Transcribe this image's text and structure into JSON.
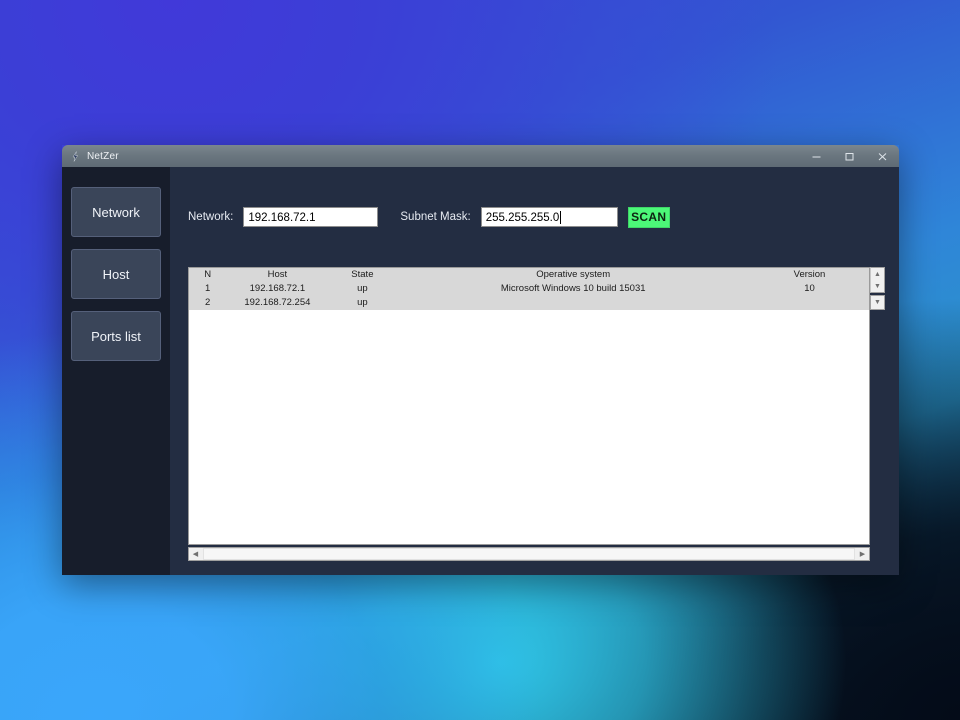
{
  "window": {
    "title": "NetZer",
    "icon": "app-lightning-icon",
    "controls": {
      "minimize": "–",
      "maximize": "☐",
      "close": "✕"
    }
  },
  "sidebar": {
    "items": [
      {
        "label": "Network"
      },
      {
        "label": "Host"
      },
      {
        "label": "Ports list"
      }
    ]
  },
  "form": {
    "network_label": "Network:",
    "network_value": "192.168.72.1",
    "network_placeholder": "",
    "subnet_label": "Subnet Mask:",
    "subnet_value": "255.255.255.0",
    "subnet_placeholder": "",
    "scan_label": "SCAN"
  },
  "results_table": {
    "columns": [
      "N",
      "Host",
      "State",
      "Operative system",
      "Version"
    ],
    "rows": [
      {
        "n": "1",
        "host": "192.168.72.1",
        "state": "up",
        "os": "Microsoft Windows 10 build 15031",
        "version": "10"
      },
      {
        "n": "2",
        "host": "192.168.72.254",
        "state": "up",
        "os": "",
        "version": ""
      }
    ]
  },
  "scrollbars": {
    "up_arrow": "▲",
    "down_arrow": "▼",
    "left_arrow": "◀",
    "right_arrow": "▶"
  },
  "colors": {
    "accent_green": "#4cf878",
    "titlebar": "#6a767f",
    "sidebar_bg": "#171d2b",
    "content_bg": "#232d42",
    "table_band": "#d8d8d8"
  }
}
